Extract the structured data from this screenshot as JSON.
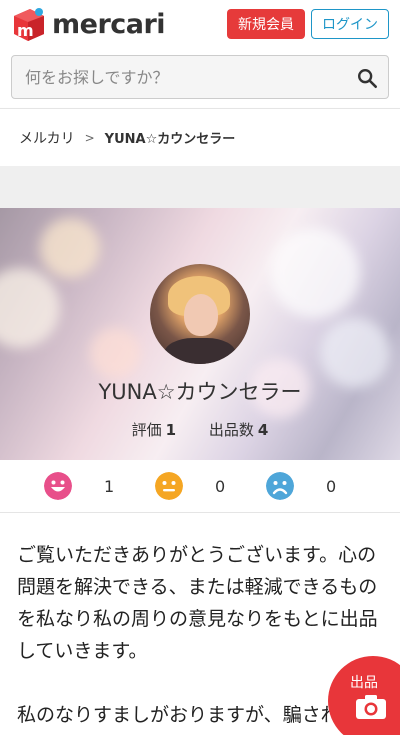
{
  "header": {
    "logo_text": "mercari",
    "register_label": "新規会員",
    "login_label": "ログイン"
  },
  "search": {
    "placeholder": "何をお探しですか？"
  },
  "breadcrumb": {
    "root": "メルカリ",
    "separator": ">",
    "current": "YUNA☆カウンセラー"
  },
  "profile": {
    "name": "YUNA☆カウンセラー",
    "rating_label": "評価",
    "rating_value": "1",
    "listings_label": "出品数",
    "listings_value": "4"
  },
  "ratings": {
    "good": "1",
    "normal": "0",
    "bad": "0"
  },
  "bio": {
    "para1": "ご覧いただきありがとうございます。心の問題を解決できる、または軽減できるものを私なり私の周りの意見なりをもとに出品していきます。",
    "para2": "私のなりすましがおりますが、騙されないようお気をつけください。"
  },
  "sell_button": {
    "label": "出品"
  },
  "colors": {
    "brand_red": "#e63a3a",
    "login_blue": "#1e96c8",
    "good_pink": "#e84f8a",
    "normal_orange": "#f5a623",
    "bad_blue": "#4ea6d9"
  },
  "icons": [
    "mercari-logo-icon",
    "search-icon",
    "good-face-icon",
    "normal-face-icon",
    "bad-face-icon",
    "camera-icon"
  ]
}
